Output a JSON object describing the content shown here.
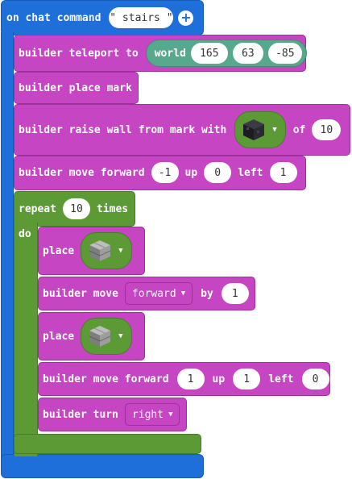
{
  "event": {
    "label": "on chat command",
    "command": "\" stairs \""
  },
  "teleport": {
    "label": "builder teleport to",
    "world": "world",
    "x": "165",
    "y": "63",
    "z": "-85"
  },
  "place_mark": {
    "label": "builder place mark"
  },
  "raise_wall": {
    "label": "builder raise wall from mark with",
    "block_icon": "blackstone-block-icon",
    "of_label": "of",
    "count": "10"
  },
  "move1": {
    "label": "builder move forward",
    "forward": "-1",
    "up_label": "up",
    "up": "0",
    "left_label": "left",
    "left": "1"
  },
  "repeat": {
    "label": "repeat",
    "times": "10",
    "times_label": "times",
    "do_label": "do"
  },
  "place1": {
    "label": "place",
    "block_icon": "stone-bricks-block-icon"
  },
  "move2": {
    "label": "builder move",
    "direction": "forward",
    "by_label": "by",
    "by": "1"
  },
  "place2": {
    "label": "place",
    "block_icon": "stone-bricks-block-icon"
  },
  "move3": {
    "label": "builder move forward",
    "forward": "1",
    "up_label": "up",
    "up": "1",
    "left_label": "left",
    "left": "0"
  },
  "turn": {
    "label": "builder turn",
    "direction": "right"
  },
  "colors": {
    "event": "#1e6fd9",
    "builder": "#c545c2",
    "loop": "#5c9a35",
    "position": "#57a88d"
  }
}
